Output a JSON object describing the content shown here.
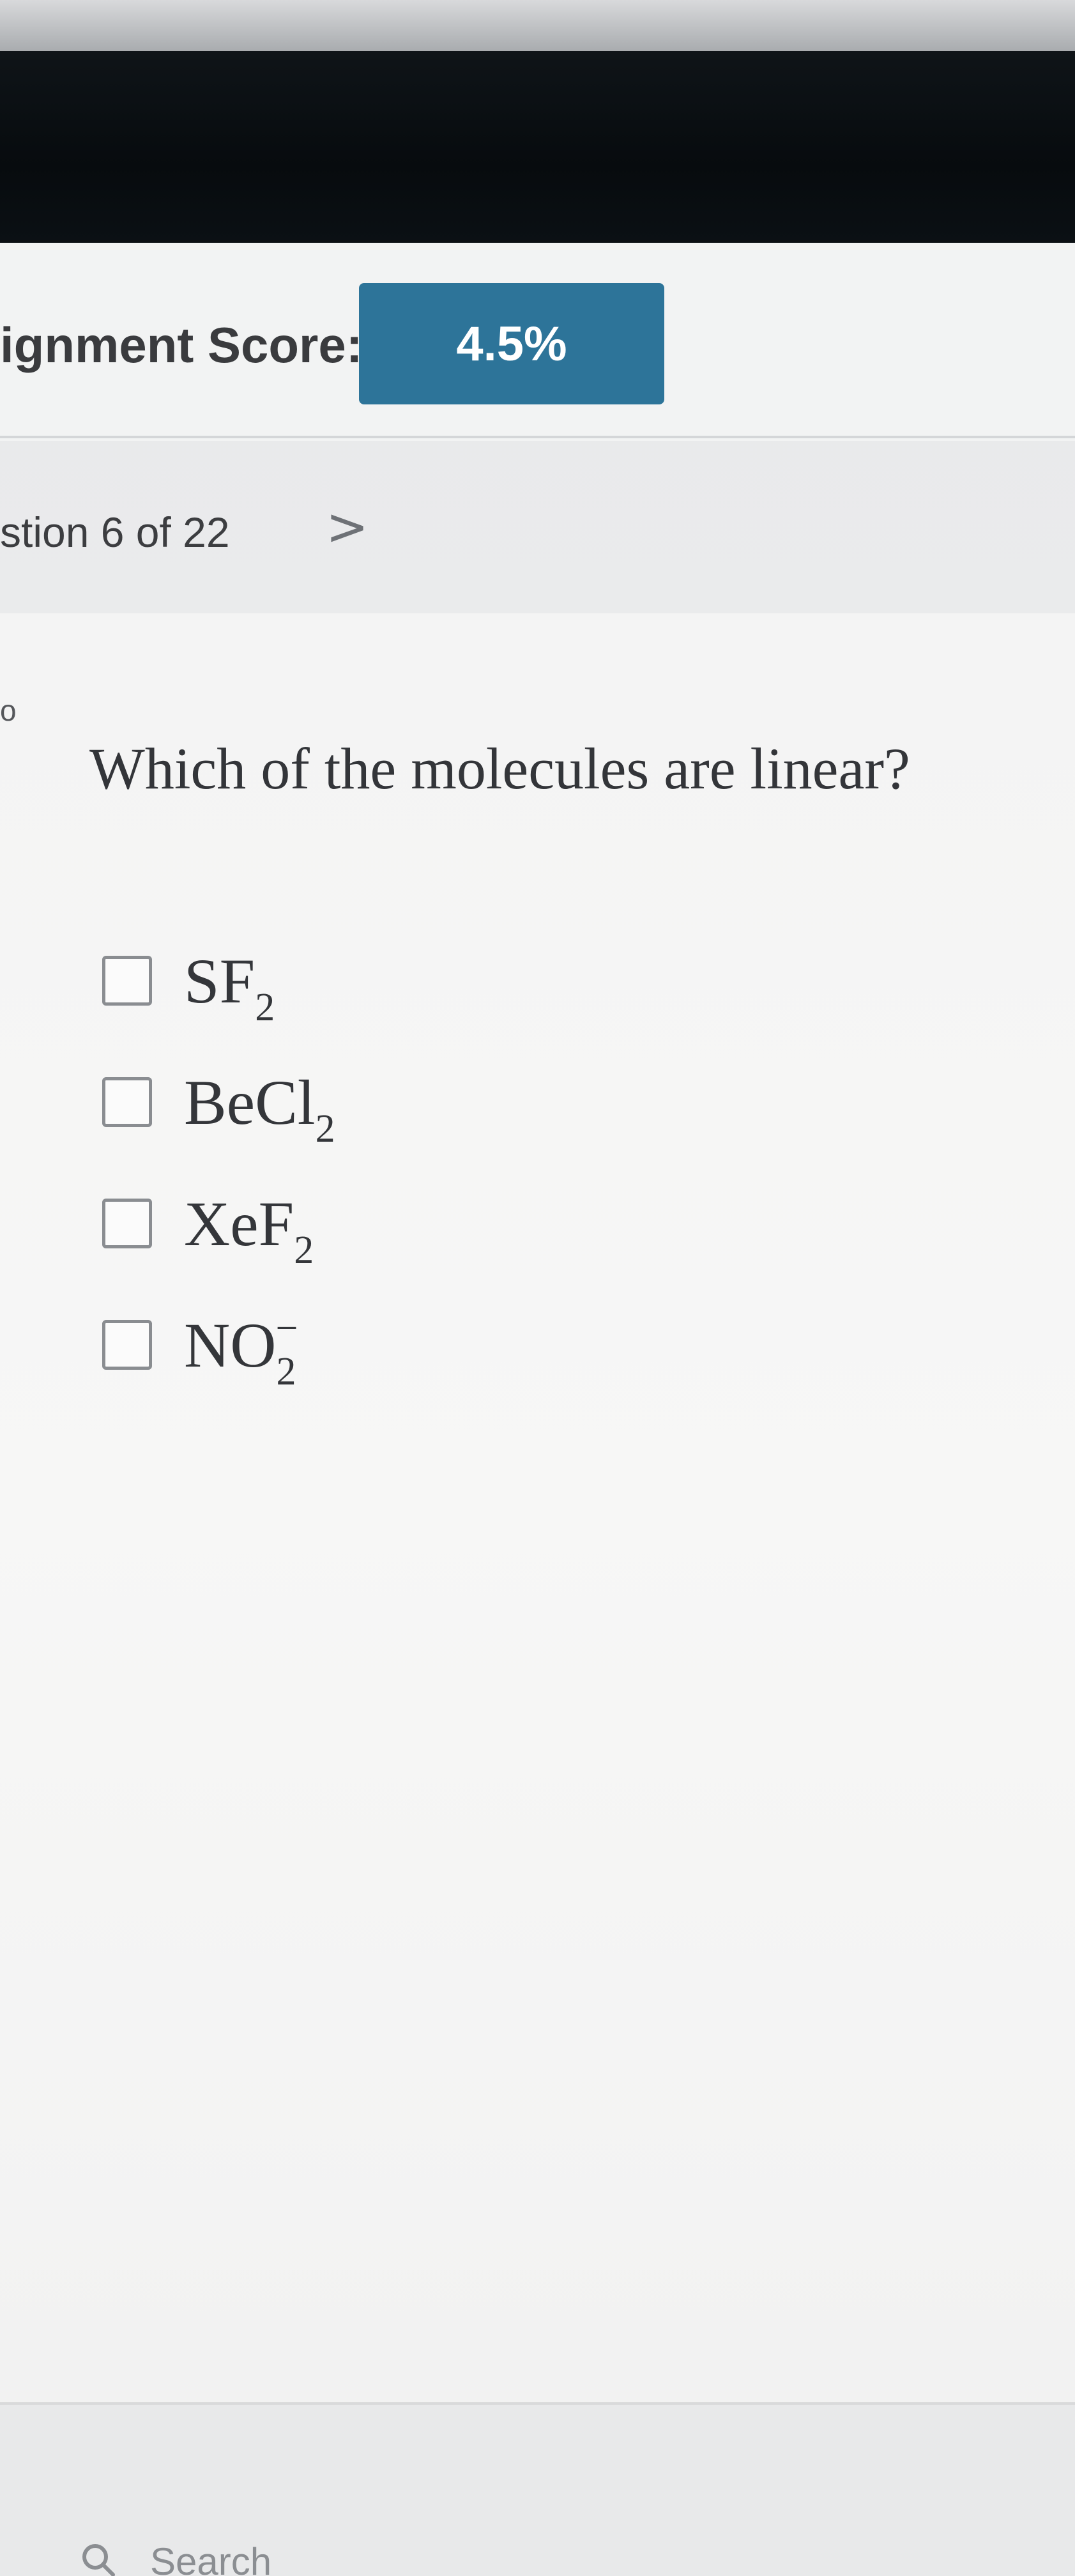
{
  "header": {
    "score_label": "ignment Score:",
    "score_value": "4.5%"
  },
  "navigation": {
    "question_counter": "stion 6 of 22",
    "next_arrow": ">"
  },
  "edge_mark": "o",
  "question": {
    "text": "Which of the molecules are linear?",
    "options": [
      {
        "base": "SF",
        "sub": "2",
        "sup": ""
      },
      {
        "base": "BeCl",
        "sub": "2",
        "sup": ""
      },
      {
        "base": "XeF",
        "sub": "2",
        "sup": ""
      },
      {
        "base": "NO",
        "sub": "2",
        "sup": "−"
      }
    ]
  },
  "footer": {
    "search_text": "Search"
  },
  "colors": {
    "score_badge": "#2d7499",
    "dark_band": "#0a0f13"
  },
  "icons": {
    "next": "chevron-right-icon",
    "search": "search-icon"
  }
}
